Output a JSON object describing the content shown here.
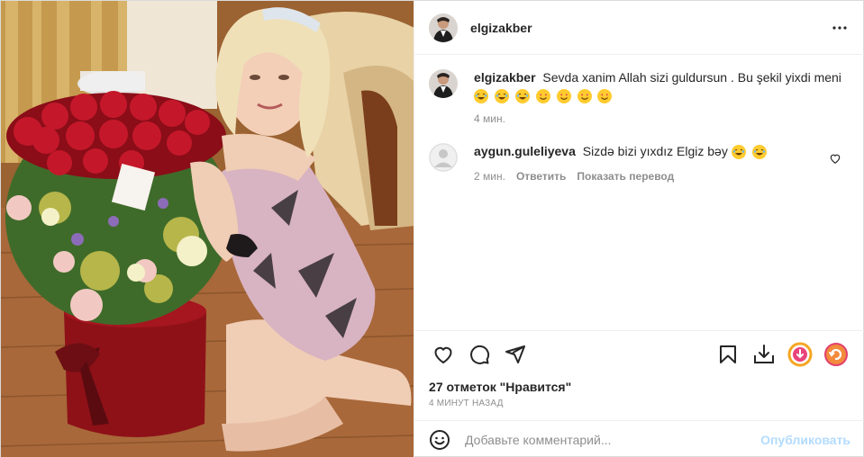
{
  "post": {
    "author": "elgizakber",
    "menu_icon": "more-horizontal-icon"
  },
  "comments": [
    {
      "user": "elgizakber",
      "text": "Sevda xanim Allah sizi guldursun . Bu şekil yixdi meni",
      "emojis": [
        "laugh",
        "laugh",
        "laugh",
        "love",
        "love",
        "love",
        "love"
      ],
      "time": "4 мин."
    },
    {
      "user": "aygun.guleliyeva",
      "text": "Sizdə bizi yıxdız Elgiz bəy",
      "emojis": [
        "laugh",
        "laugh"
      ],
      "time": "2 мин.",
      "reply": "Ответить",
      "translate": "Показать перевод"
    }
  ],
  "actions": {
    "like_icon": "heart-icon",
    "comment_icon": "comment-icon",
    "share_icon": "send-icon",
    "save_icon": "bookmark-icon",
    "download_icon": "download-icon"
  },
  "likes_text": "27 отметок \"Нравится\"",
  "timestamp": "4 МИНУТ НАЗАД",
  "add_comment": {
    "placeholder": "Добавьте комментарий...",
    "publish_label": "Опубликовать"
  },
  "colors": {
    "publish_disabled": "#b3dbff",
    "text": "#262626",
    "muted": "#8e8e8e",
    "border": "#efefef"
  }
}
